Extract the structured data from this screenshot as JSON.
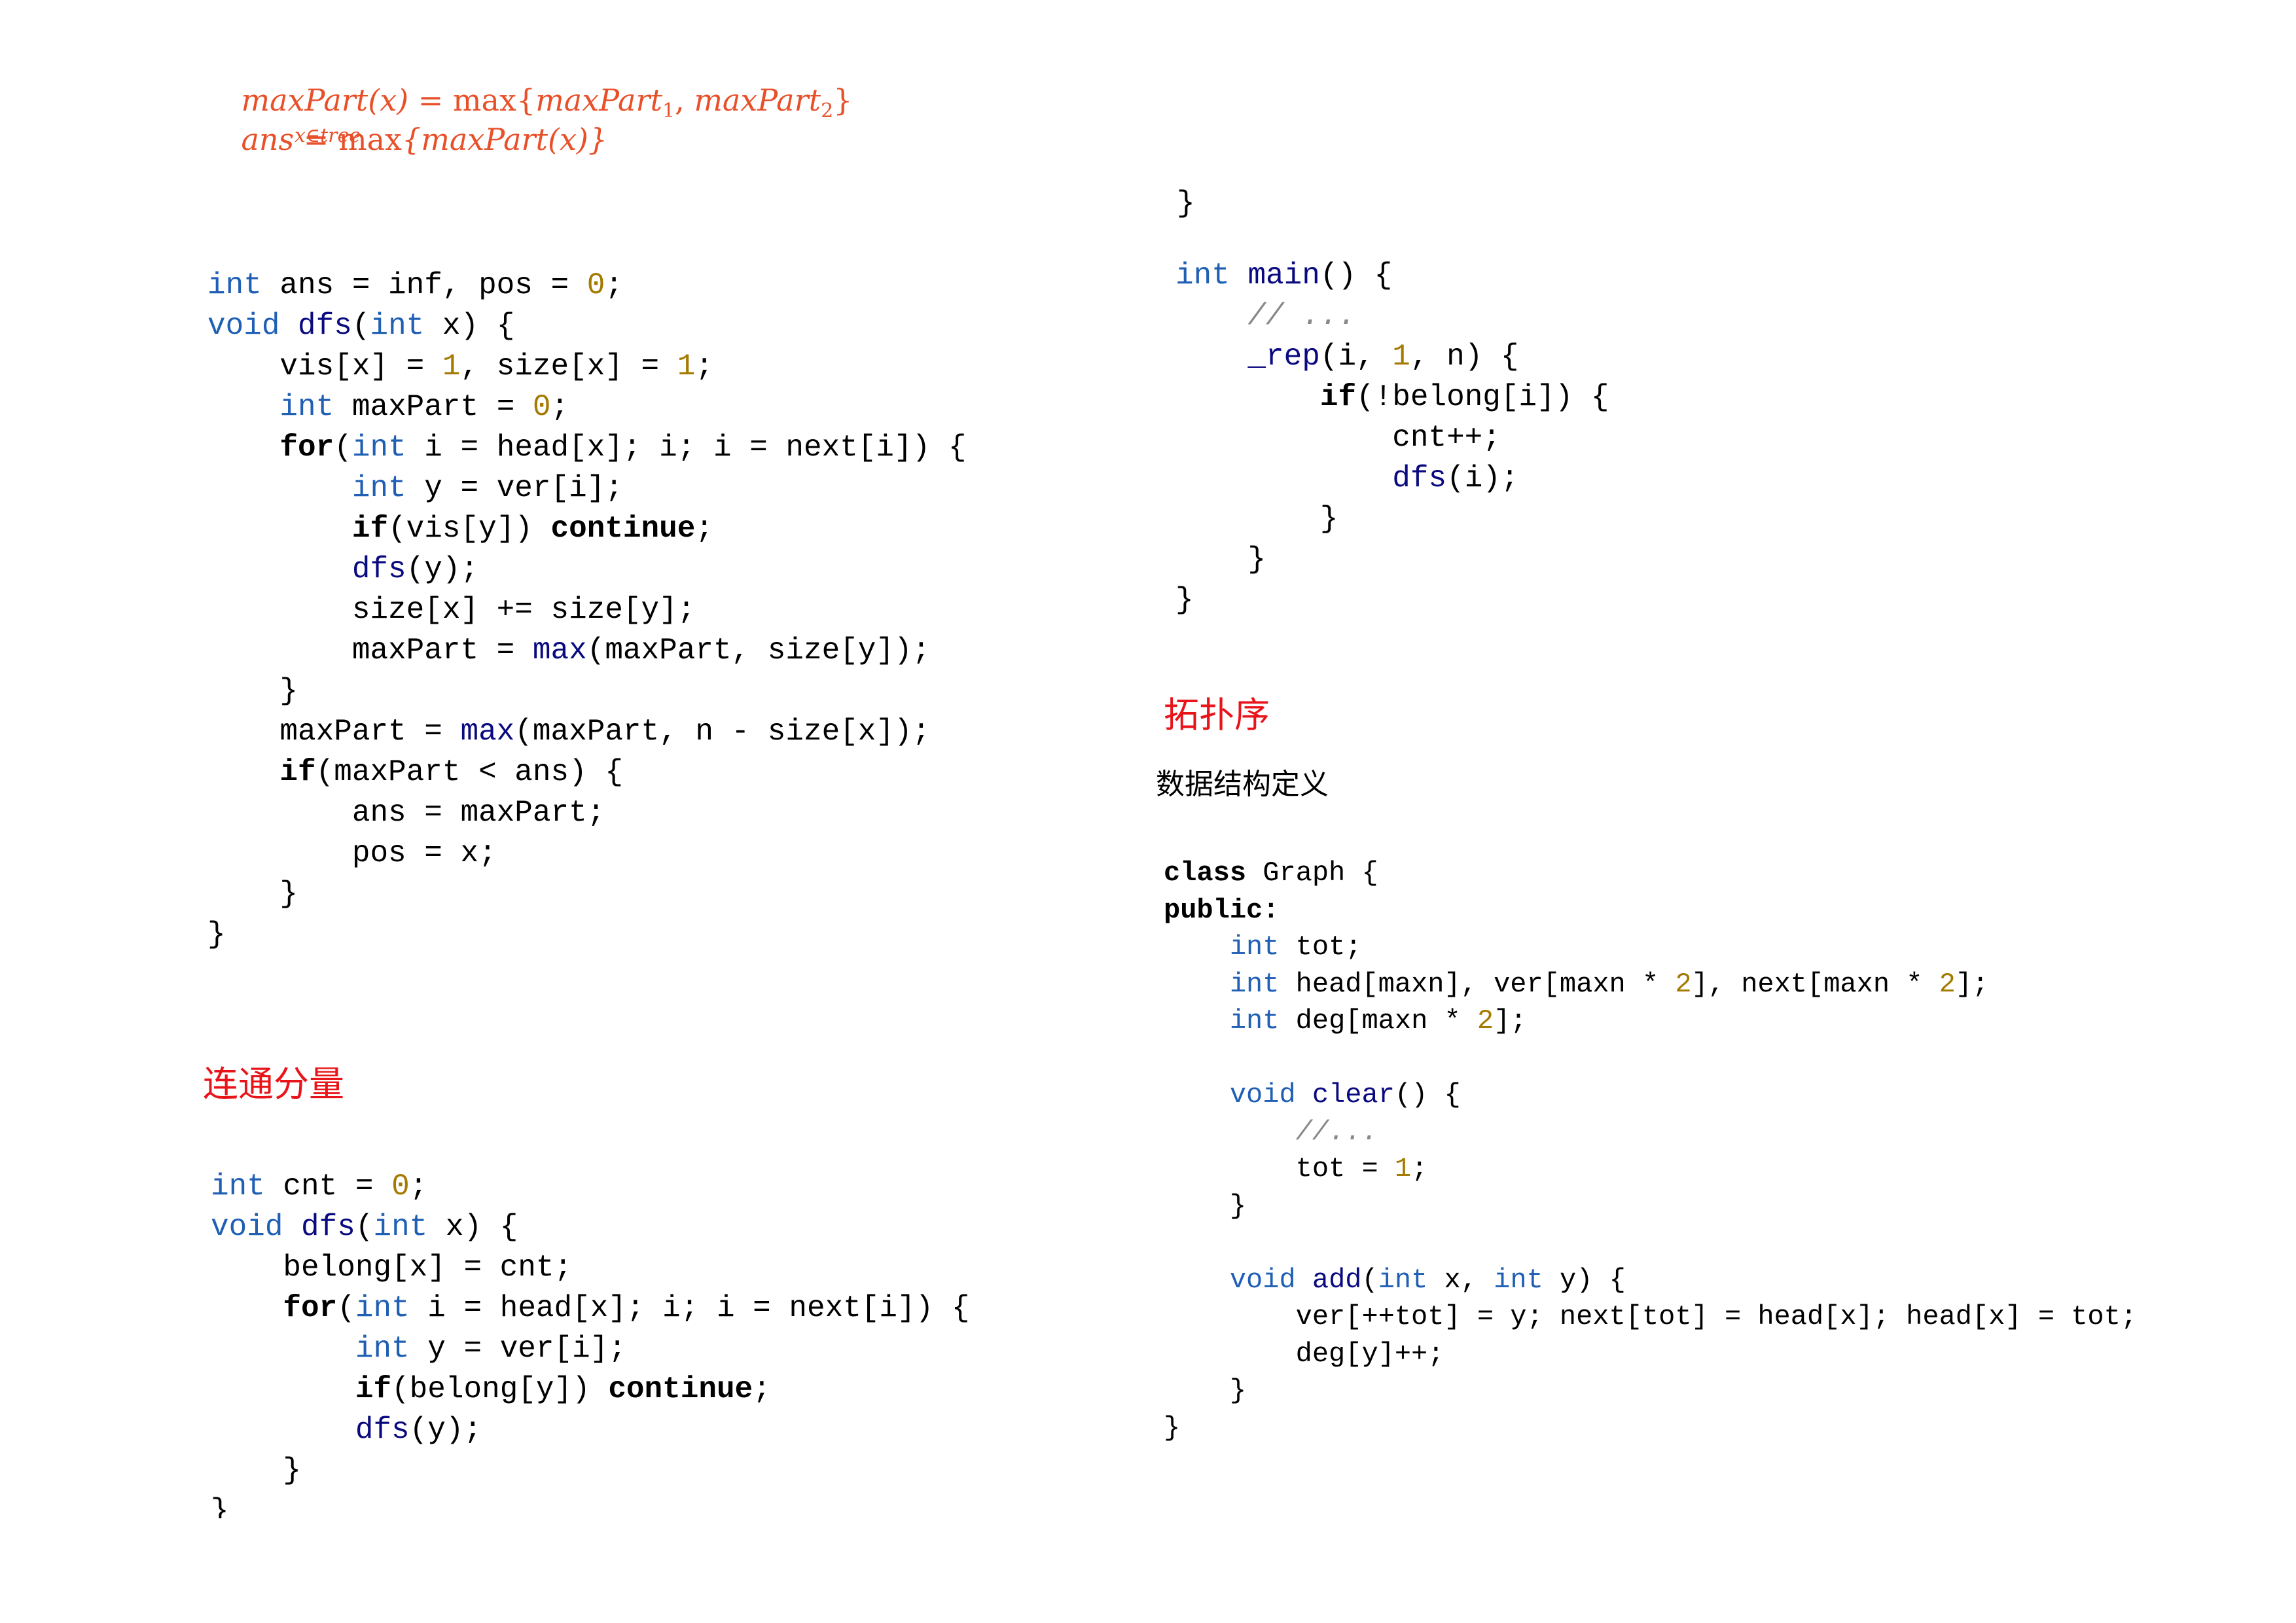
{
  "formulas": {
    "line1": {
      "lhs": "maxPart(x)",
      "eq": " = ",
      "op": "max",
      "open": "{",
      "a": "maxPart",
      "a_sub": "1",
      "sep": ", ",
      "b": "maxPart",
      "b_sub": "2",
      "close": "}"
    },
    "line2": {
      "lhs": "ans",
      "eq": " = ",
      "op": "max",
      "under": "x∈tree",
      "body": "{maxPart(x)}"
    }
  },
  "colors": {
    "formula": "#e8502a",
    "heading": "#e8141a",
    "type_keyword": "#1f5fb4",
    "function": "#0a0a80",
    "number": "#a57a00",
    "comment": "#888888"
  },
  "headings": {
    "components": "连通分量",
    "toposort": "拓扑序",
    "ds_definition": "数据结构定义"
  },
  "code_blocks": {
    "centroid": [
      [
        [
          "k",
          "int"
        ],
        [
          "t",
          " ans = inf, pos = "
        ],
        [
          "n",
          "0"
        ],
        [
          "t",
          ";"
        ]
      ],
      [
        [
          "k",
          "void"
        ],
        [
          "t",
          " "
        ],
        [
          "f",
          "dfs"
        ],
        [
          "t",
          "("
        ],
        [
          "k",
          "int"
        ],
        [
          "t",
          " x) {"
        ]
      ],
      [
        [
          "t",
          "    vis[x] = "
        ],
        [
          "n",
          "1"
        ],
        [
          "t",
          ", size[x] = "
        ],
        [
          "n",
          "1"
        ],
        [
          "t",
          ";"
        ]
      ],
      [
        [
          "t",
          "    "
        ],
        [
          "k",
          "int"
        ],
        [
          "t",
          " maxPart = "
        ],
        [
          "n",
          "0"
        ],
        [
          "t",
          ";"
        ]
      ],
      [
        [
          "t",
          "    "
        ],
        [
          "b",
          "for"
        ],
        [
          "t",
          "("
        ],
        [
          "k",
          "int"
        ],
        [
          "t",
          " i = head[x]; i; i = next[i]) {"
        ]
      ],
      [
        [
          "t",
          "        "
        ],
        [
          "k",
          "int"
        ],
        [
          "t",
          " y = ver[i];"
        ]
      ],
      [
        [
          "t",
          "        "
        ],
        [
          "b",
          "if"
        ],
        [
          "t",
          "(vis[y]) "
        ],
        [
          "b",
          "continue"
        ],
        [
          "t",
          ";"
        ]
      ],
      [
        [
          "t",
          "        "
        ],
        [
          "f",
          "dfs"
        ],
        [
          "t",
          "(y);"
        ]
      ],
      [
        [
          "t",
          "        size[x] += size[y];"
        ]
      ],
      [
        [
          "t",
          "        maxPart = "
        ],
        [
          "f",
          "max"
        ],
        [
          "t",
          "(maxPart, size[y]);"
        ]
      ],
      [
        [
          "t",
          "    }"
        ]
      ],
      [
        [
          "t",
          "    maxPart = "
        ],
        [
          "f",
          "max"
        ],
        [
          "t",
          "(maxPart, n - size[x]);"
        ]
      ],
      [
        [
          "t",
          "    "
        ],
        [
          "b",
          "if"
        ],
        [
          "t",
          "(maxPart < ans) {"
        ]
      ],
      [
        [
          "t",
          "        ans = maxPart;"
        ]
      ],
      [
        [
          "t",
          "        pos = x;"
        ]
      ],
      [
        [
          "t",
          "    }"
        ]
      ],
      [
        [
          "t",
          "}"
        ]
      ]
    ],
    "components": [
      [
        [
          "k",
          "int"
        ],
        [
          "t",
          " cnt = "
        ],
        [
          "n",
          "0"
        ],
        [
          "t",
          ";"
        ]
      ],
      [
        [
          "k",
          "void"
        ],
        [
          "t",
          " "
        ],
        [
          "f",
          "dfs"
        ],
        [
          "t",
          "("
        ],
        [
          "k",
          "int"
        ],
        [
          "t",
          " x) {"
        ]
      ],
      [
        [
          "t",
          "    belong[x] = cnt;"
        ]
      ],
      [
        [
          "t",
          "    "
        ],
        [
          "b",
          "for"
        ],
        [
          "t",
          "("
        ],
        [
          "k",
          "int"
        ],
        [
          "t",
          " i = head[x]; i; i = next[i]) {"
        ]
      ],
      [
        [
          "t",
          "        "
        ],
        [
          "k",
          "int"
        ],
        [
          "t",
          " y = ver[i];"
        ]
      ],
      [
        [
          "t",
          "        "
        ],
        [
          "b",
          "if"
        ],
        [
          "t",
          "(belong[y]) "
        ],
        [
          "b",
          "continue"
        ],
        [
          "t",
          ";"
        ]
      ],
      [
        [
          "t",
          "        "
        ],
        [
          "f",
          "dfs"
        ],
        [
          "t",
          "(y);"
        ]
      ],
      [
        [
          "t",
          "    }"
        ]
      ],
      [
        [
          "t",
          "}"
        ]
      ]
    ],
    "top_right_brace": [
      [
        [
          "t",
          "}"
        ]
      ]
    ],
    "main": [
      [
        [
          "k",
          "int"
        ],
        [
          "t",
          " "
        ],
        [
          "f",
          "main"
        ],
        [
          "t",
          "() {"
        ]
      ],
      [
        [
          "t",
          "    "
        ],
        [
          "cm",
          "// ..."
        ]
      ],
      [
        [
          "t",
          "    "
        ],
        [
          "f",
          "_rep"
        ],
        [
          "t",
          "(i, "
        ],
        [
          "n",
          "1"
        ],
        [
          "t",
          ", n) {"
        ]
      ],
      [
        [
          "t",
          "        "
        ],
        [
          "b",
          "if"
        ],
        [
          "t",
          "(!belong[i]) {"
        ]
      ],
      [
        [
          "t",
          "            cnt++;"
        ]
      ],
      [
        [
          "t",
          "            "
        ],
        [
          "f",
          "dfs"
        ],
        [
          "t",
          "(i);"
        ]
      ],
      [
        [
          "t",
          "        }"
        ]
      ],
      [
        [
          "t",
          "    }"
        ]
      ],
      [
        [
          "t",
          "}"
        ]
      ]
    ],
    "graph": [
      [
        [
          "b",
          "class"
        ],
        [
          "t",
          " Graph {"
        ]
      ],
      [
        [
          "b",
          "public:"
        ]
      ],
      [
        [
          "t",
          "    "
        ],
        [
          "k",
          "int"
        ],
        [
          "t",
          " tot;"
        ]
      ],
      [
        [
          "t",
          "    "
        ],
        [
          "k",
          "int"
        ],
        [
          "t",
          " head[maxn], ver[maxn * "
        ],
        [
          "n",
          "2"
        ],
        [
          "t",
          "], next[maxn * "
        ],
        [
          "n",
          "2"
        ],
        [
          "t",
          "];"
        ]
      ],
      [
        [
          "t",
          "    "
        ],
        [
          "k",
          "int"
        ],
        [
          "t",
          " deg[maxn * "
        ],
        [
          "n",
          "2"
        ],
        [
          "t",
          "];"
        ]
      ],
      [
        [
          "t",
          ""
        ]
      ],
      [
        [
          "t",
          "    "
        ],
        [
          "k",
          "void"
        ],
        [
          "t",
          " "
        ],
        [
          "f",
          "clear"
        ],
        [
          "t",
          "() {"
        ]
      ],
      [
        [
          "t",
          "        "
        ],
        [
          "cm",
          "//..."
        ]
      ],
      [
        [
          "t",
          "        tot = "
        ],
        [
          "n",
          "1"
        ],
        [
          "t",
          ";"
        ]
      ],
      [
        [
          "t",
          "    }"
        ]
      ],
      [
        [
          "t",
          ""
        ]
      ],
      [
        [
          "t",
          "    "
        ],
        [
          "k",
          "void"
        ],
        [
          "t",
          " "
        ],
        [
          "f",
          "add"
        ],
        [
          "t",
          "("
        ],
        [
          "k",
          "int"
        ],
        [
          "t",
          " x, "
        ],
        [
          "k",
          "int"
        ],
        [
          "t",
          " y) {"
        ]
      ],
      [
        [
          "t",
          "        ver[++tot] = y; next[tot] = head[x]; head[x] = tot;"
        ]
      ],
      [
        [
          "t",
          "        deg[y]++;"
        ]
      ],
      [
        [
          "t",
          "    }"
        ]
      ],
      [
        [
          "t",
          "}"
        ]
      ]
    ]
  }
}
